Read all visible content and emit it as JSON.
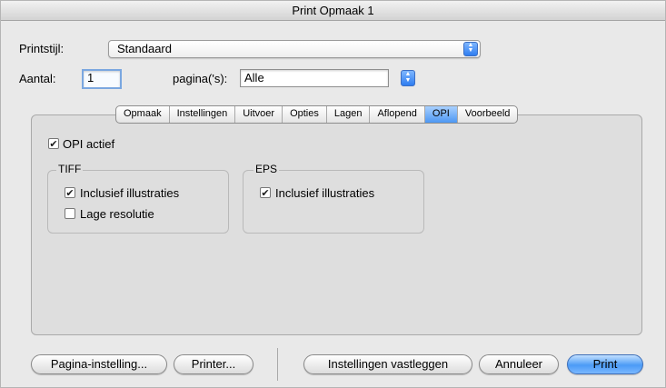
{
  "window": {
    "title": "Print Opmaak 1"
  },
  "style_row": {
    "label": "Printstijl:",
    "value": "Standaard"
  },
  "count_row": {
    "label": "Aantal:",
    "value": "1",
    "pages_label": "pagina('s):",
    "pages_value": "Alle"
  },
  "tabs": [
    {
      "label": "Opmaak",
      "active": false
    },
    {
      "label": "Instellingen",
      "active": false
    },
    {
      "label": "Uitvoer",
      "active": false
    },
    {
      "label": "Opties",
      "active": false
    },
    {
      "label": "Lagen",
      "active": false
    },
    {
      "label": "Aflopend",
      "active": false
    },
    {
      "label": "OPI",
      "active": true
    },
    {
      "label": "Voorbeeld",
      "active": false
    }
  ],
  "opi": {
    "active_label": "OPI actief",
    "active_checked": true,
    "tiff": {
      "title": "TIFF",
      "include_label": "Inclusief illustraties",
      "include_checked": true,
      "lowres_label": "Lage resolutie",
      "lowres_checked": false
    },
    "eps": {
      "title": "EPS",
      "include_label": "Inclusief illustraties",
      "include_checked": true
    }
  },
  "buttons": {
    "page_setup": "Pagina-instelling...",
    "printer": "Printer...",
    "capture": "Instellingen vastleggen",
    "cancel": "Annuleer",
    "print": "Print"
  },
  "colors": {
    "accent": "#4b9bf6",
    "window_bg": "#e9e9e9"
  },
  "icons": {
    "popup": "updown-arrows-icon",
    "check": "checkmark-icon"
  }
}
